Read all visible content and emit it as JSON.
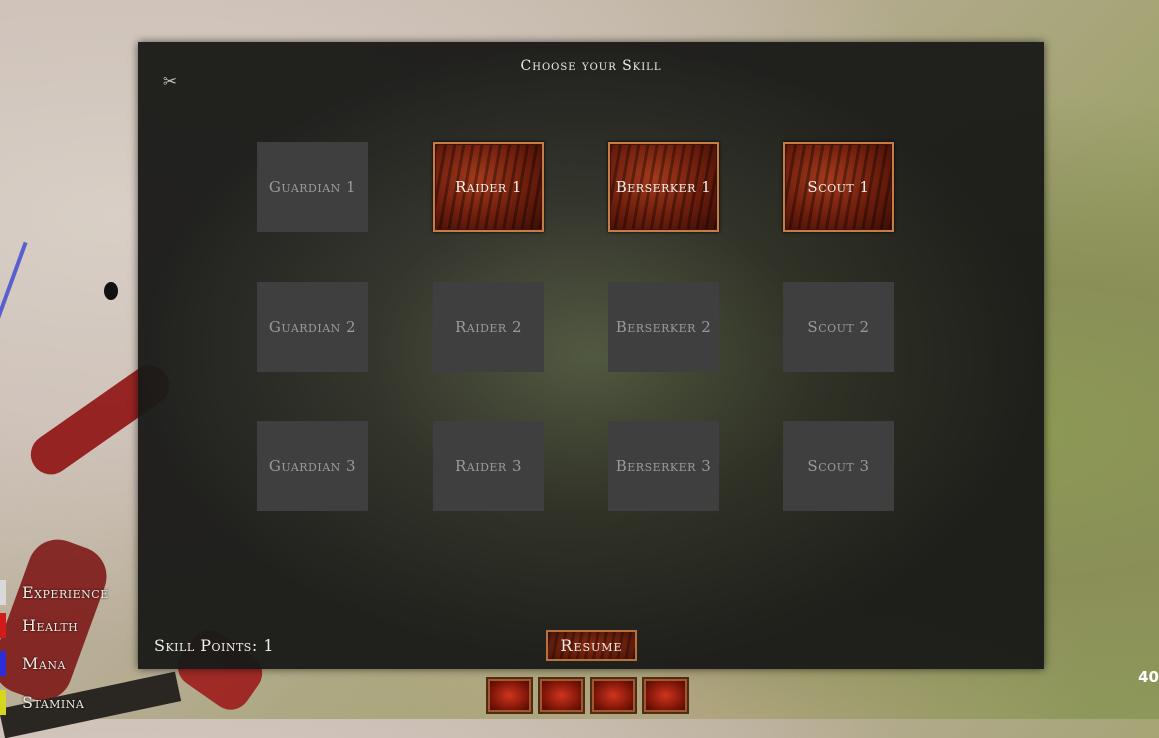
{
  "panel": {
    "title": "Choose your Skill",
    "corner_icon": "✂",
    "skill_points": "Skill Points: 1",
    "resume_label": "Resume"
  },
  "skills": [
    [
      {
        "label": "Guardian 1",
        "unlocked": false
      },
      {
        "label": "Raider 1",
        "unlocked": true
      },
      {
        "label": "Berserker 1",
        "unlocked": true
      },
      {
        "label": "Scout 1",
        "unlocked": true
      }
    ],
    [
      {
        "label": "Guardian 2",
        "unlocked": false
      },
      {
        "label": "Raider 2",
        "unlocked": false
      },
      {
        "label": "Berserker 2",
        "unlocked": false
      },
      {
        "label": "Scout 2",
        "unlocked": false
      }
    ],
    [
      {
        "label": "Guardian 3",
        "unlocked": false
      },
      {
        "label": "Raider 3",
        "unlocked": false
      },
      {
        "label": "Berserker 3",
        "unlocked": false
      },
      {
        "label": "Scout 3",
        "unlocked": false
      }
    ]
  ],
  "hud": {
    "bars": [
      {
        "label": "Experience",
        "color": "#d9d9d9"
      },
      {
        "label": "Health",
        "color": "#d21b1b"
      },
      {
        "label": "Mana",
        "color": "#2d2dd6"
      },
      {
        "label": "Stamina",
        "color": "#d6d61e"
      }
    ]
  },
  "action_bar": {
    "slots": 4
  },
  "fps": "40"
}
